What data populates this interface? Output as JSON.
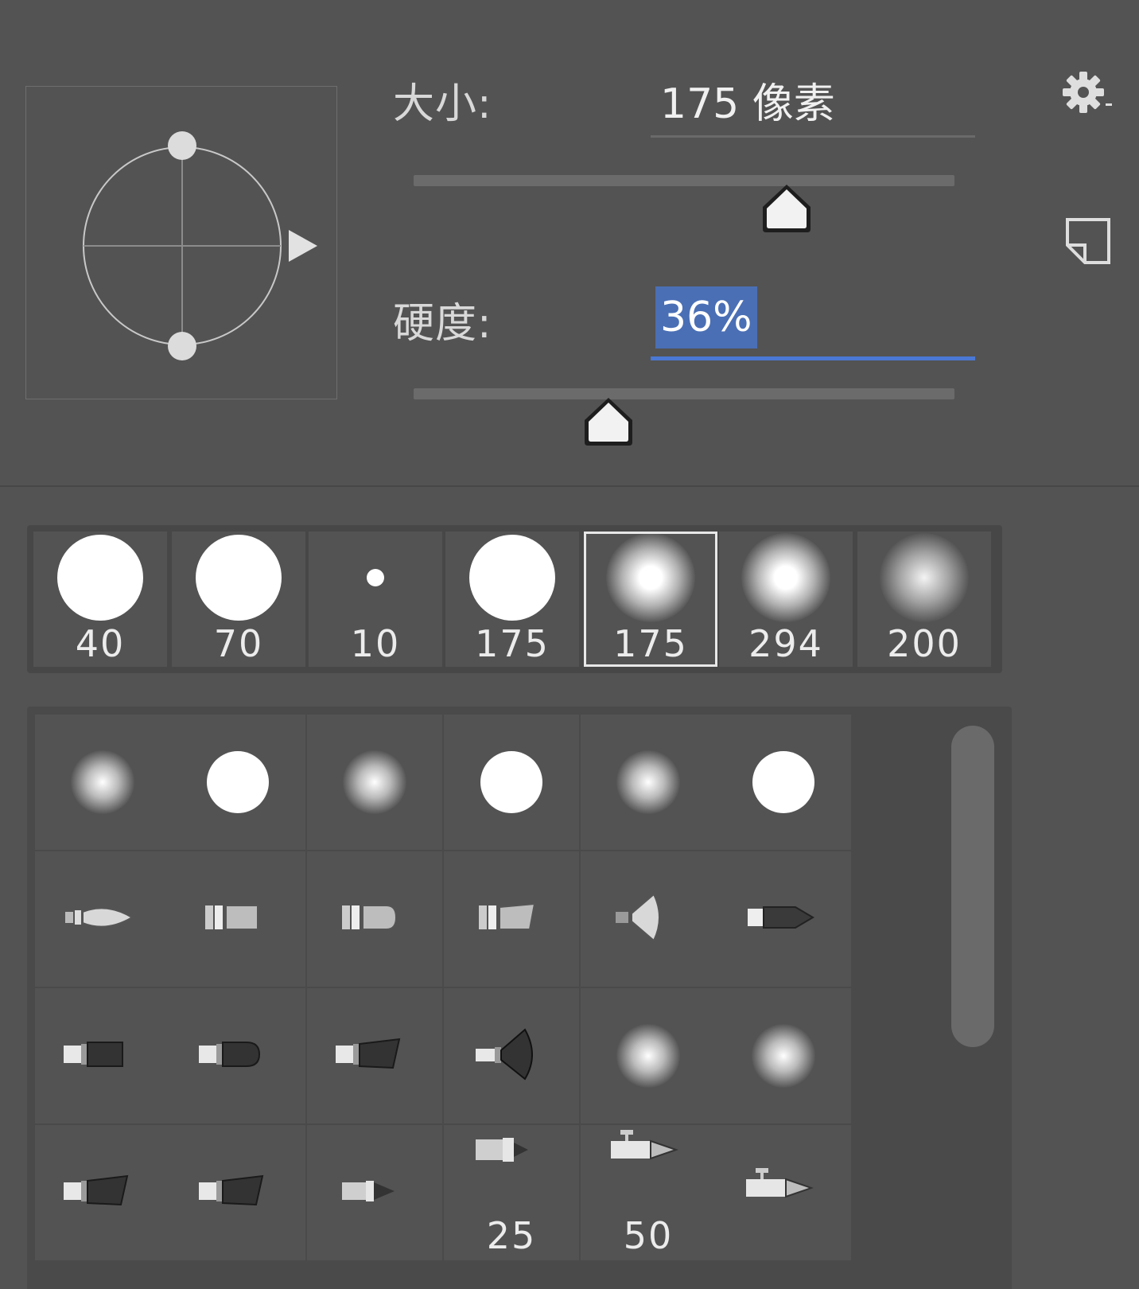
{
  "brush": {
    "size_label": "大小:",
    "size_value": "175 像素",
    "size_slider_fraction": 0.69,
    "hardness_label": "硬度:",
    "hardness_value": "36%",
    "hardness_slider_fraction": 0.36
  },
  "colors": {
    "panel_bg": "#535353",
    "selection_highlight": "#4a6fb5",
    "focus_underline": "#4a78d4"
  },
  "icons": {
    "settings": "gear-icon",
    "new_preset": "new-preset-icon",
    "angle_roundness": "brush-angle-roundness-icon"
  },
  "presets": [
    {
      "label": "40",
      "kind": "hard"
    },
    {
      "label": "70",
      "kind": "hard"
    },
    {
      "label": "10",
      "kind": "hard-small"
    },
    {
      "label": "175",
      "kind": "hard"
    },
    {
      "label": "175",
      "kind": "soft",
      "selected": true
    },
    {
      "label": "294",
      "kind": "soft"
    },
    {
      "label": "200",
      "kind": "soft-faint"
    }
  ],
  "brush_grid": {
    "rows": [
      [
        {
          "icon": "soft-round-icon"
        },
        {
          "icon": "hard-round-icon"
        },
        {
          "icon": "soft-round-icon"
        },
        {
          "icon": "hard-round-icon"
        },
        {
          "icon": "soft-round-icon"
        },
        {
          "icon": "hard-round-icon"
        }
      ],
      [
        {
          "icon": "round-bristle-brush-icon"
        },
        {
          "icon": "flat-bristle-brush-icon"
        },
        {
          "icon": "blunt-bristle-brush-icon"
        },
        {
          "icon": "angled-bristle-brush-icon"
        },
        {
          "icon": "fan-bristle-brush-icon"
        },
        {
          "icon": "point-bristle-brush-icon"
        }
      ],
      [
        {
          "icon": "flat-brush-icon"
        },
        {
          "icon": "round-brush-icon"
        },
        {
          "icon": "angle-brush-icon"
        },
        {
          "icon": "fan-brush-icon"
        },
        {
          "icon": "soft-round-icon"
        },
        {
          "icon": "soft-round-icon"
        }
      ],
      [
        {
          "icon": "angle-brush-icon"
        },
        {
          "icon": "angle-brush-icon"
        },
        {
          "icon": "point-brush-icon"
        },
        {
          "icon": "airbrush-icon",
          "label": "25"
        },
        {
          "icon": "airbrush-pen-icon",
          "label": "50"
        },
        {
          "icon": "airbrush-pen-icon"
        }
      ]
    ]
  }
}
